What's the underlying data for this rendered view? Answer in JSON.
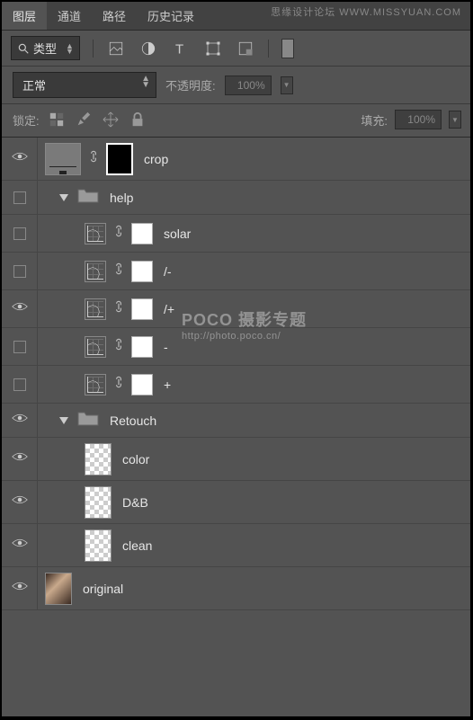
{
  "tabs": {
    "layers": "图层",
    "channels": "通道",
    "paths": "路径",
    "history": "历史记录"
  },
  "toolbar": {
    "filter_label": "类型",
    "blend_mode": "正常",
    "opacity_label": "不透明度:",
    "opacity_value": "100%",
    "lock_label": "锁定:",
    "fill_label": "填充:",
    "fill_value": "100%"
  },
  "layers": [
    {
      "name": "crop"
    },
    {
      "name": "help"
    },
    {
      "name": "solar"
    },
    {
      "name": "/-"
    },
    {
      "name": "/+"
    },
    {
      "name": "-"
    },
    {
      "name": "+"
    },
    {
      "name": "Retouch"
    },
    {
      "name": "color"
    },
    {
      "name": "D&B"
    },
    {
      "name": "clean"
    },
    {
      "name": "original"
    }
  ],
  "watermarks": {
    "top": "思缘设计论坛 WWW.MISSYUAN.COM",
    "mid_title": "POCO 摄影专题",
    "mid_url": "http://photo.poco.cn/"
  }
}
